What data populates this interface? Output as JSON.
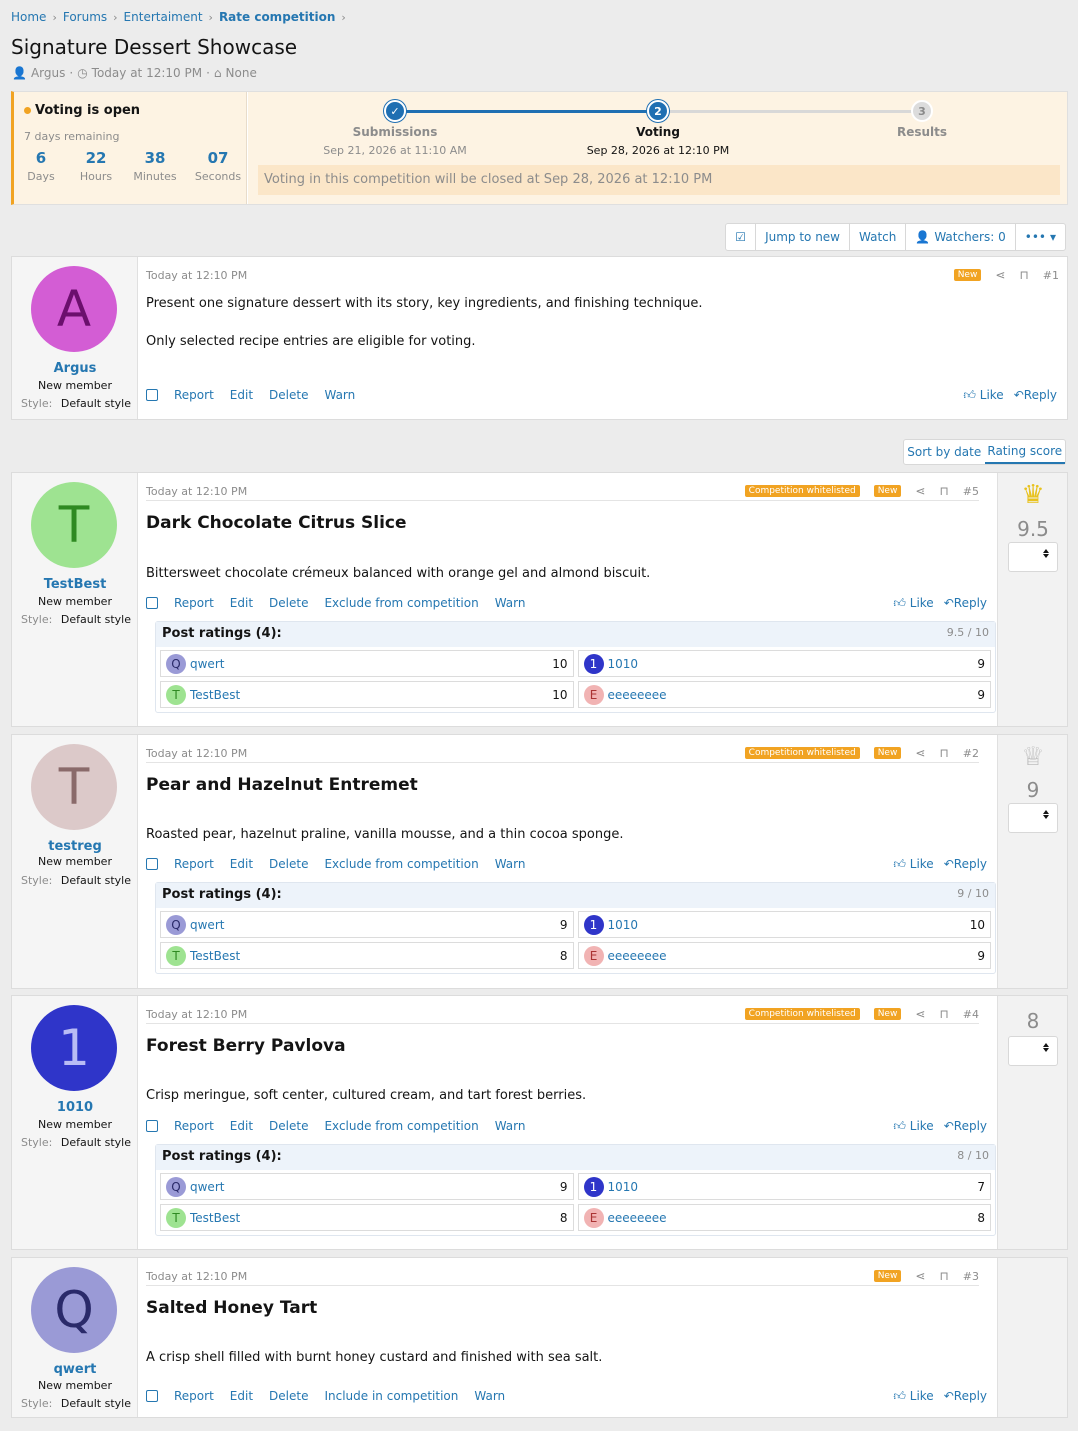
{
  "breadcrumb": {
    "items": [
      "Home",
      "Forums",
      "Entertaiment",
      "Rate competition"
    ]
  },
  "page": {
    "title": "Signature Dessert Showcase",
    "author": "Argus",
    "date": "Today at 12:10 PM",
    "tags": "None"
  },
  "competition": {
    "status": "Voting is open",
    "remaining": "7 days remaining",
    "countdown": [
      {
        "value": "6",
        "label": "Days"
      },
      {
        "value": "22",
        "label": "Hours"
      },
      {
        "value": "38",
        "label": "Minutes"
      },
      {
        "value": "07",
        "label": "Seconds"
      }
    ],
    "steps": [
      {
        "num": "✓",
        "label": "Submissions",
        "date": "Sep 21, 2026 at 11:10 AM"
      },
      {
        "num": "2",
        "label": "Voting",
        "date": "Sep 28, 2026 at 12:10 PM"
      },
      {
        "num": "3",
        "label": "Results",
        "date": ""
      }
    ],
    "note": "Voting in this competition will be closed at Sep 28, 2026 at 12:10 PM"
  },
  "toolbar": {
    "jump": "Jump to new",
    "watch": "Watch",
    "watchers": "Watchers: 0",
    "more": "•••"
  },
  "sort": {
    "date": "Sort by date",
    "rating": "Rating score"
  },
  "common": {
    "new_tag": "New",
    "whitelist_tag": "Competition whitelisted",
    "report": "Report",
    "edit": "Edit",
    "delete": "Delete",
    "exclude": "Exclude from competition",
    "include": "Include in competition",
    "warn": "Warn",
    "like": "Like",
    "reply": "Reply",
    "user_title": "New member",
    "style_key": "Style:",
    "style_val": "Default style",
    "ratings_header": "Post ratings (4):"
  },
  "first_post": {
    "user": "Argus",
    "letter": "A",
    "date": "Today at 12:10 PM",
    "num": "#1",
    "line1": "Present one signature dessert with its story, key ingredients, and finishing technique.",
    "line2": "Only selected recipe entries are eligible for voting."
  },
  "entries": [
    {
      "user": "TestBest",
      "letter": "T",
      "date": "Today at 12:10 PM",
      "num": "#5",
      "title": "Dark Chocolate Citrus Slice",
      "text": "Bittersweet chocolate crémeux balanced with orange gel and almond biscuit.",
      "score": "9.5",
      "score_of": "9.5 / 10",
      "ratings": [
        {
          "u": "qwert",
          "l": "Q",
          "v": "10"
        },
        {
          "u": "1010",
          "l": "1",
          "v": "9"
        },
        {
          "u": "TestBest",
          "l": "T",
          "v": "10"
        },
        {
          "u": "eeeeeeee",
          "l": "E",
          "v": "9"
        }
      ]
    },
    {
      "user": "testreg",
      "letter": "T",
      "date": "Today at 12:10 PM",
      "num": "#2",
      "title": "Pear and Hazelnut Entremet",
      "text": "Roasted pear, hazelnut praline, vanilla mousse, and a thin cocoa sponge.",
      "score": "9",
      "score_of": "9 / 10",
      "ratings": [
        {
          "u": "qwert",
          "l": "Q",
          "v": "9"
        },
        {
          "u": "1010",
          "l": "1",
          "v": "10"
        },
        {
          "u": "TestBest",
          "l": "T",
          "v": "8"
        },
        {
          "u": "eeeeeeee",
          "l": "E",
          "v": "9"
        }
      ]
    },
    {
      "user": "1010",
      "letter": "1",
      "date": "Today at 12:10 PM",
      "num": "#4",
      "title": "Forest Berry Pavlova",
      "text": "Crisp meringue, soft center, cultured cream, and tart forest berries.",
      "score": "8",
      "score_of": "8 / 10",
      "ratings": [
        {
          "u": "qwert",
          "l": "Q",
          "v": "9"
        },
        {
          "u": "1010",
          "l": "1",
          "v": "7"
        },
        {
          "u": "TestBest",
          "l": "T",
          "v": "8"
        },
        {
          "u": "eeeeeeee",
          "l": "E",
          "v": "8"
        }
      ]
    },
    {
      "user": "qwert",
      "letter": "Q",
      "date": "Today at 12:10 PM",
      "num": "#3",
      "title": "Salted Honey Tart",
      "text": "A crisp shell filled with burnt honey custard and finished with sea salt."
    }
  ],
  "colors": {
    "accent": "#2577b1",
    "orange": "#f1a322",
    "argus_av": "#d35dd4",
    "testbest_av": "#9ee391",
    "testreg_av": "#dcc9c9",
    "n1010_av": "#2f35c9",
    "qwert_av": "#9a9ad6",
    "eee_av": "#f1b3b3",
    "gold": "#e8c21e"
  }
}
